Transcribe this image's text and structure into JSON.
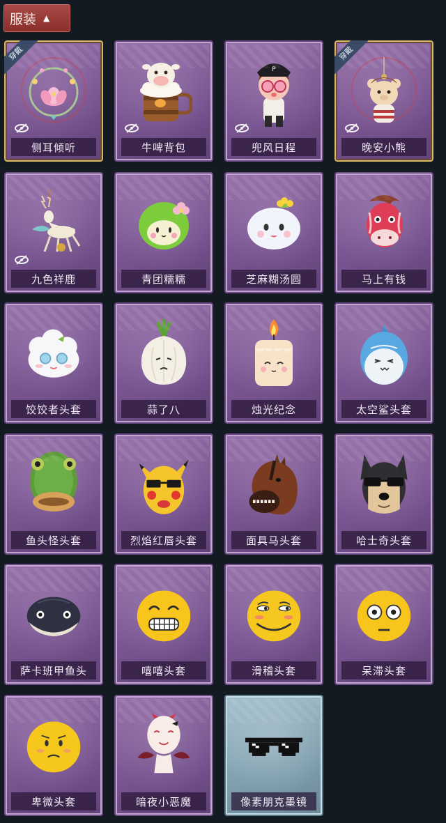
{
  "header": {
    "title": "服装",
    "toggle_icon": "chevron-up-icon"
  },
  "badge_text": "穿戴",
  "items": [
    {
      "label": "侧耳倾听",
      "worn": true,
      "hidden_icon": true,
      "icon": "lotus-wreath"
    },
    {
      "label": "牛啤背包",
      "worn": false,
      "hidden_icon": true,
      "icon": "cow-beer-mug"
    },
    {
      "label": "兜风日程",
      "worn": false,
      "hidden_icon": true,
      "icon": "pink-glasses-girl"
    },
    {
      "label": "晚安小熊",
      "worn": true,
      "hidden_icon": true,
      "icon": "bear-charm"
    },
    {
      "label": "九色祥鹿",
      "worn": false,
      "hidden_icon": true,
      "icon": "deer-charm"
    },
    {
      "label": "青团糯糯",
      "worn": false,
      "hidden_icon": false,
      "icon": "green-rice-ball"
    },
    {
      "label": "芝麻糊汤圆",
      "worn": false,
      "hidden_icon": false,
      "icon": "white-dumpling"
    },
    {
      "label": "马上有钱",
      "worn": false,
      "hidden_icon": false,
      "icon": "red-horse"
    },
    {
      "label": "饺饺者头套",
      "worn": false,
      "hidden_icon": false,
      "icon": "dumpling-head"
    },
    {
      "label": "蒜了八",
      "worn": false,
      "hidden_icon": false,
      "icon": "garlic-head"
    },
    {
      "label": "烛光纪念",
      "worn": false,
      "hidden_icon": false,
      "icon": "candle-head"
    },
    {
      "label": "太空鲨头套",
      "worn": false,
      "hidden_icon": false,
      "icon": "shark-head"
    },
    {
      "label": "鱼头怪头套",
      "worn": false,
      "hidden_icon": false,
      "icon": "fish-mask"
    },
    {
      "label": "烈焰红唇头套",
      "worn": false,
      "hidden_icon": false,
      "icon": "yellow-mask"
    },
    {
      "label": "面具马头套",
      "worn": false,
      "hidden_icon": false,
      "icon": "horse-mask"
    },
    {
      "label": "哈士奇头套",
      "worn": false,
      "hidden_icon": false,
      "icon": "husky-mask"
    },
    {
      "label": "萨卡班甲鱼头",
      "worn": false,
      "hidden_icon": false,
      "icon": "fish-head"
    },
    {
      "label": "嘻嘻头套",
      "worn": false,
      "hidden_icon": false,
      "icon": "grin-emoji"
    },
    {
      "label": "滑稽头套",
      "worn": false,
      "hidden_icon": false,
      "icon": "smirk-emoji"
    },
    {
      "label": "呆滞头套",
      "worn": false,
      "hidden_icon": false,
      "icon": "dazed-emoji"
    },
    {
      "label": "卑微头套",
      "worn": false,
      "hidden_icon": false,
      "icon": "humble-emoji"
    },
    {
      "label": "暗夜小恶魔",
      "worn": false,
      "hidden_icon": false,
      "icon": "little-devil"
    },
    {
      "label": "像素朋克墨镜",
      "worn": false,
      "hidden_icon": false,
      "icon": "pixel-sunglasses"
    }
  ]
}
